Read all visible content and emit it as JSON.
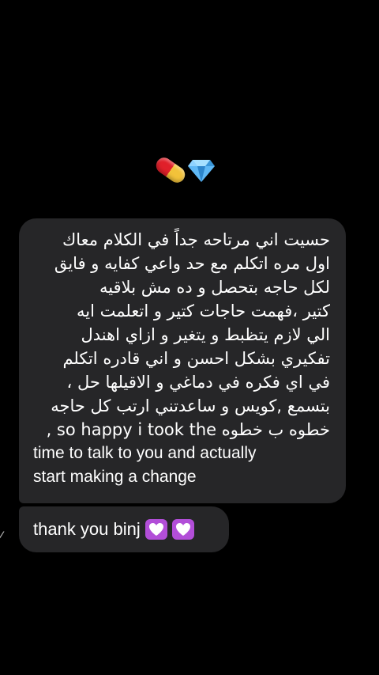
{
  "reactions": [
    {
      "icon": "pill-icon"
    },
    {
      "icon": "gem-icon"
    }
  ],
  "message_main": {
    "lines": [
      "حسيت اني مرتاحه جداً في الكلام معاك",
      "اول مره اتكلم مع حد واعي كفايه و فايق",
      "لكل حاجه بتحصل و ده مش بلاقيه",
      "كتير ،فهمت حاجات كتير و اتعلمت ايه",
      "الي لازم يتظبط و يتغير و ازاي اهندل",
      "تفكيري بشكل احسن و اني قادره اتكلم",
      "في اي فكره في دماغي و الاقيلها حل ،",
      "بتسمع ,كويس و ساعدتني ارتب كل حاجه",
      "خطوه ب خطوه so happy i took the ,",
      "time to talk to you and actually",
      "start making a change"
    ]
  },
  "message_second": {
    "text": "thank you binj",
    "emoji": [
      "heart-icon",
      "heart-icon"
    ]
  },
  "colors": {
    "background": "#000000",
    "bubble": "#262628",
    "heart_bg": "#b24ed8"
  }
}
